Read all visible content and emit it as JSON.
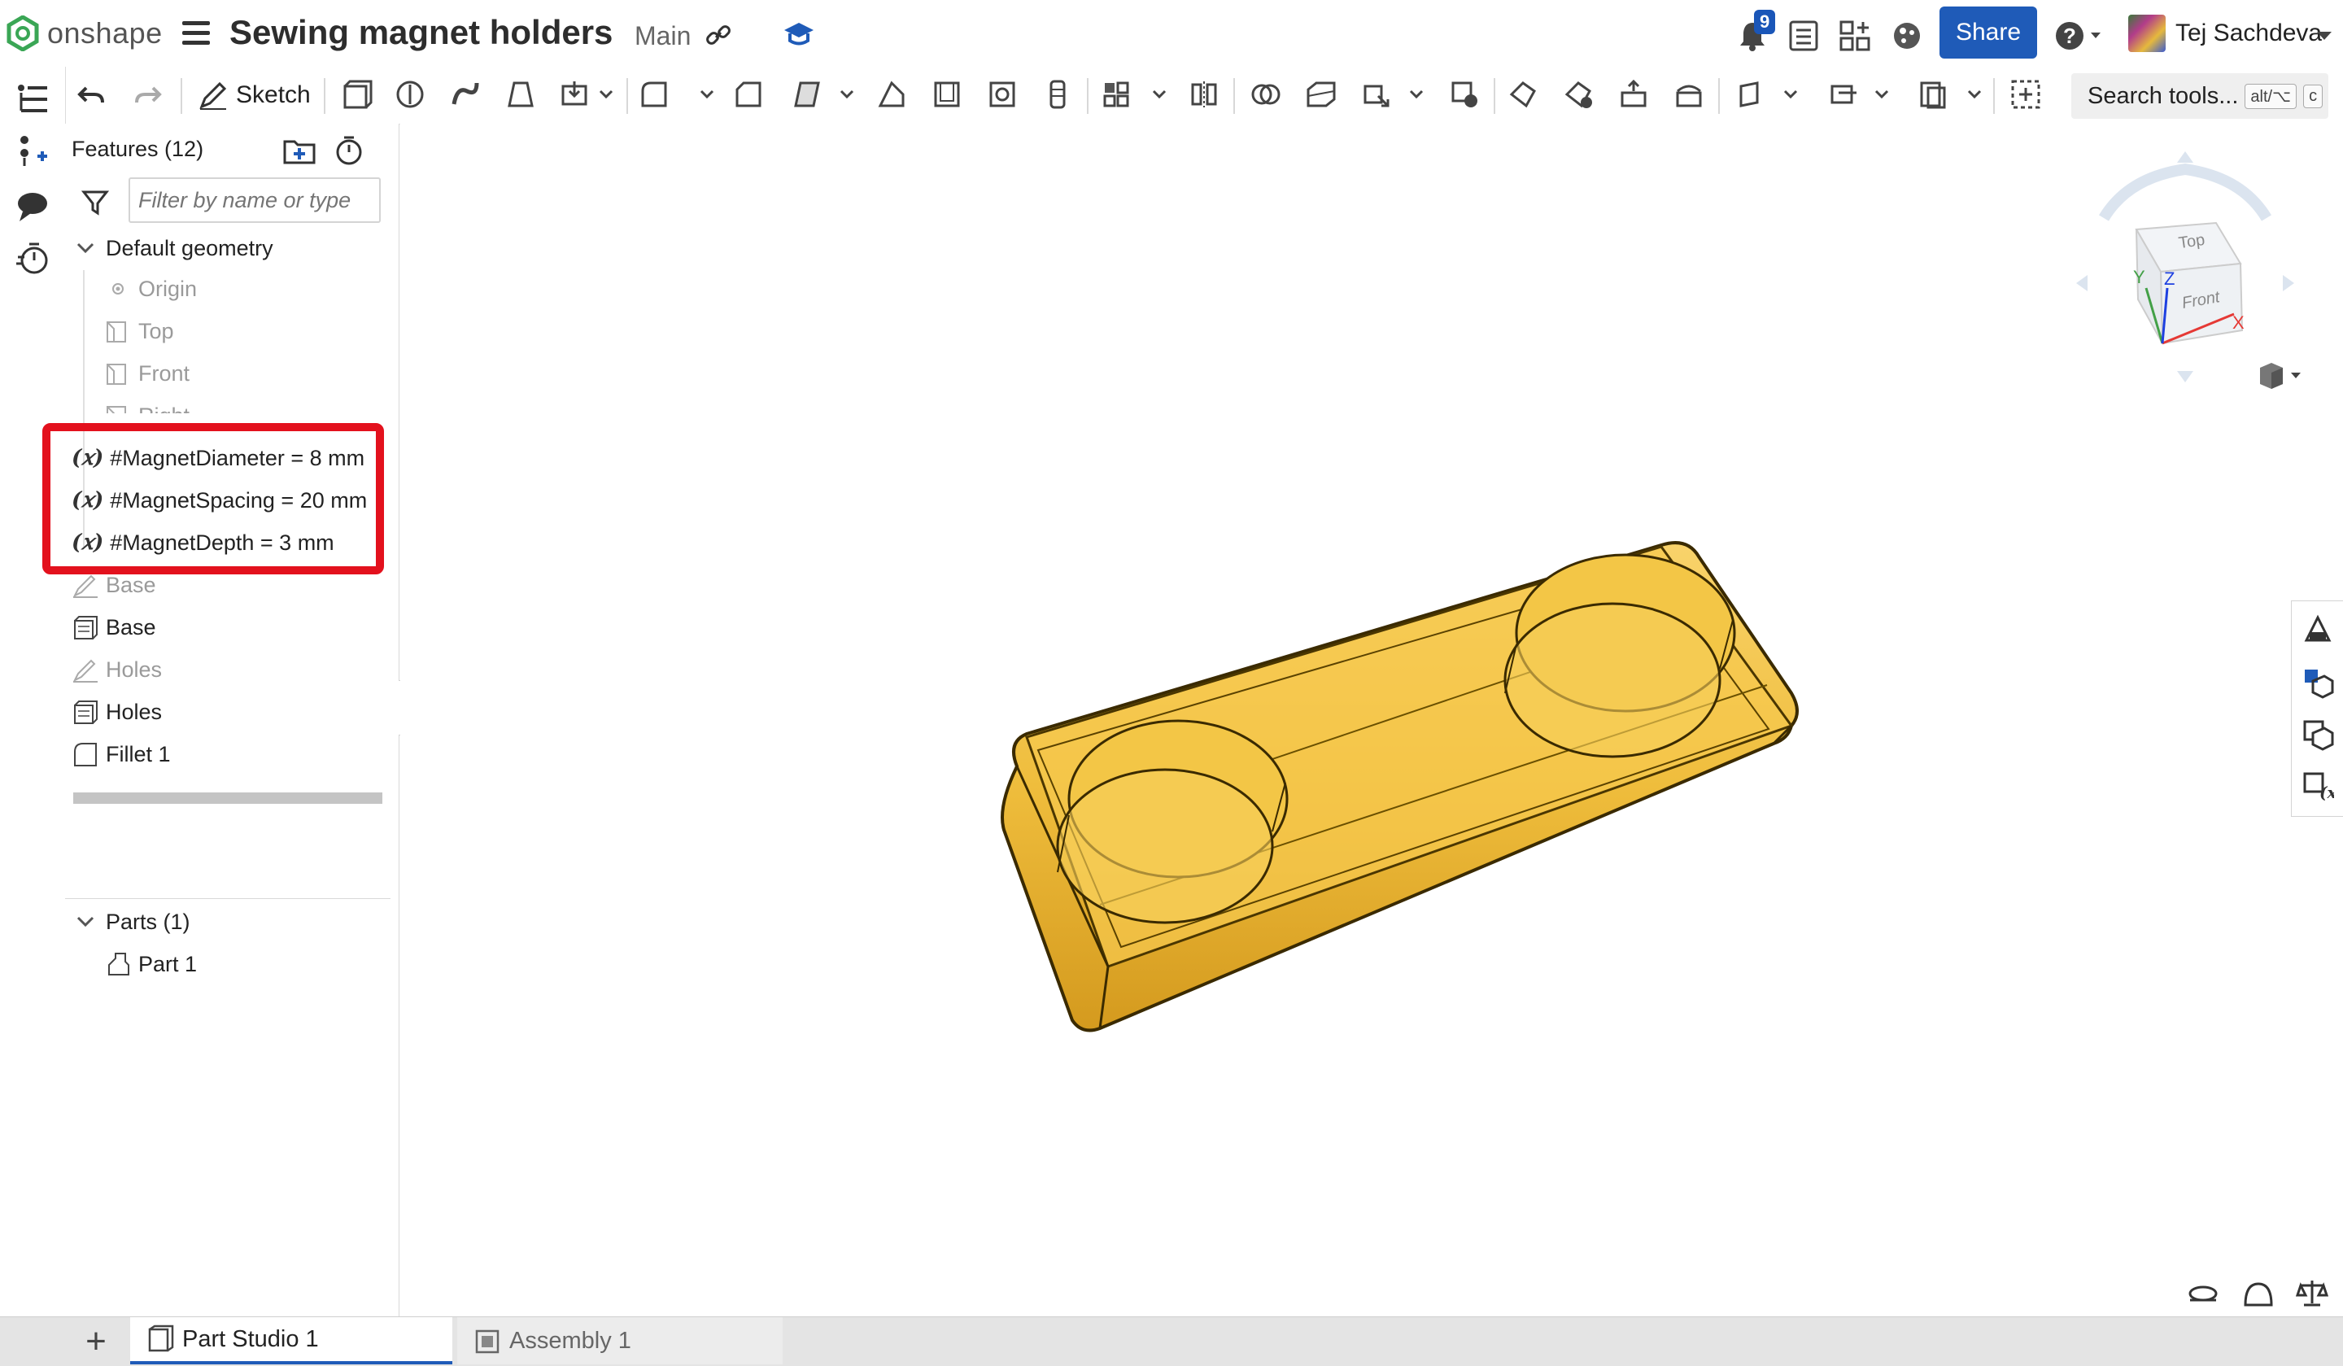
{
  "app": {
    "brand": "onshape",
    "document_title": "Sewing magnet holders",
    "branch": "Main",
    "notification_count": "9",
    "share_label": "Share",
    "user_name": "Tej Sachdeva"
  },
  "toolbar": {
    "sketch_label": "Sketch",
    "search_label": "Search tools...",
    "search_shortcut_1": "alt/⌥",
    "search_shortcut_2": "c"
  },
  "features": {
    "title": "Features (12)",
    "filter_placeholder": "Filter by name or type",
    "default_geometry_label": "Default geometry",
    "items": [
      {
        "label": "Origin",
        "state": "grey",
        "icon": "origin-icon"
      },
      {
        "label": "Top",
        "state": "grey",
        "icon": "plane-icon"
      },
      {
        "label": "Front",
        "state": "grey",
        "icon": "plane-icon"
      },
      {
        "label": "Right",
        "state": "grey",
        "icon": "plane-icon"
      },
      {
        "label": "#MagnetDiameter = 8 mm",
        "state": "variable",
        "icon": "variable-icon"
      },
      {
        "label": "#MagnetSpacing = 20 mm",
        "state": "variable",
        "icon": "variable-icon"
      },
      {
        "label": "#MagnetDepth = 3 mm",
        "state": "variable",
        "icon": "variable-icon"
      },
      {
        "label": "Base",
        "state": "grey",
        "icon": "sketch-icon"
      },
      {
        "label": "Base",
        "state": "normal",
        "icon": "extrude-icon"
      },
      {
        "label": "Holes",
        "state": "grey",
        "icon": "sketch-icon"
      },
      {
        "label": "Holes",
        "state": "normal",
        "icon": "extrude-icon"
      },
      {
        "label": "Fillet 1",
        "state": "normal",
        "icon": "fillet-icon"
      }
    ],
    "variable_symbol": "(𝑥)"
  },
  "parts": {
    "title": "Parts (1)",
    "items": [
      "Part 1"
    ]
  },
  "view_cube": {
    "top": "Top",
    "front": "Front",
    "axis_x": "X",
    "axis_y": "Y",
    "axis_z": "Z"
  },
  "tabs": [
    {
      "label": "Part Studio 1",
      "active": true
    },
    {
      "label": "Assembly 1",
      "active": false
    }
  ],
  "colors": {
    "accent": "#1f5bb8",
    "highlight": "#e3111d",
    "part": "#f2c244"
  }
}
